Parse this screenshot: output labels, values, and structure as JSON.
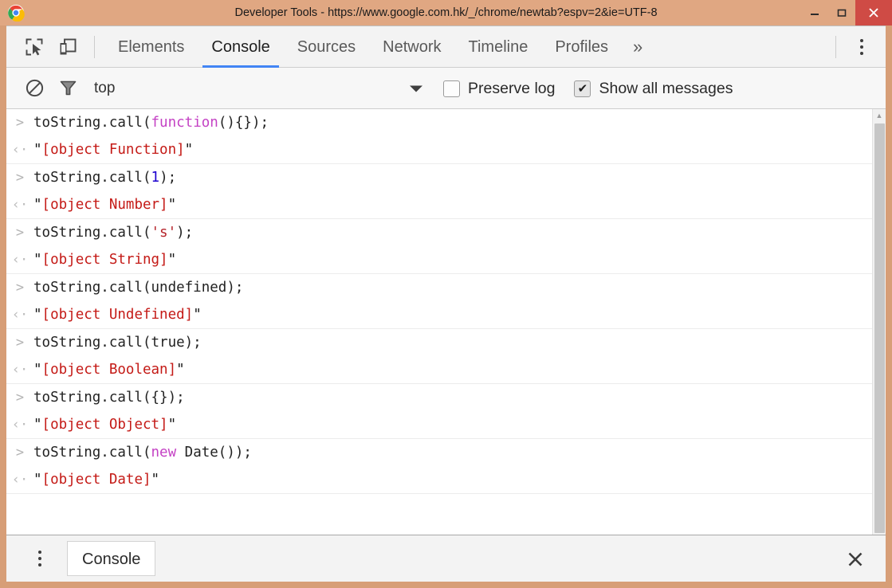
{
  "window": {
    "title": "Developer Tools - https://www.google.com.hk/_/chrome/newtab?espv=2&ie=UTF-8",
    "logo_icon": "chrome-logo-icon",
    "minimize_label": "–",
    "maximize_label": "❐",
    "close_label": "✕",
    "frame_color": "#d79e77",
    "titlebar_color": "#e0a782",
    "close_button_color": "#cf4b45"
  },
  "tabstrip": {
    "inspect_icon": "inspect-element-icon",
    "device_icon": "device-toolbar-icon",
    "more_tabs_label": "»",
    "menu_icon": "main-menu-kebab-icon",
    "accent_color": "#4285f4",
    "tabs": [
      {
        "label": "Elements",
        "active": false
      },
      {
        "label": "Console",
        "active": true
      },
      {
        "label": "Sources",
        "active": false
      },
      {
        "label": "Network",
        "active": false
      },
      {
        "label": "Timeline",
        "active": false
      },
      {
        "label": "Profiles",
        "active": false
      }
    ]
  },
  "filterbar": {
    "clear_icon": "clear-console-icon",
    "filter_icon": "filter-funnel-icon",
    "context": "top",
    "context_arrow": "▼",
    "checkboxes": [
      {
        "label": "Preserve log",
        "checked": false,
        "mark": ""
      },
      {
        "label": "Show all messages",
        "checked": true,
        "mark": "✔"
      }
    ]
  },
  "console": {
    "prompt_glyph": ">",
    "result_glyph": "‹·",
    "groups": [
      {
        "input": [
          {
            "t": "toString.call(",
            "c": "plain"
          },
          {
            "t": "function",
            "c": "kw2"
          },
          {
            "t": "(){});",
            "c": "plain"
          }
        ],
        "output_quote": "\"",
        "output_body": "[object Function]"
      },
      {
        "input": [
          {
            "t": "toString.call(",
            "c": "plain"
          },
          {
            "t": "1",
            "c": "num"
          },
          {
            "t": ");",
            "c": "plain"
          }
        ],
        "output_quote": "\"",
        "output_body": "[object Number]"
      },
      {
        "input": [
          {
            "t": "toString.call(",
            "c": "plain"
          },
          {
            "t": "'s'",
            "c": "str"
          },
          {
            "t": ");",
            "c": "plain"
          }
        ],
        "output_quote": "\"",
        "output_body": "[object String]"
      },
      {
        "input": [
          {
            "t": "toString.call(undefined);",
            "c": "plain"
          }
        ],
        "output_quote": "\"",
        "output_body": "[object Undefined]"
      },
      {
        "input": [
          {
            "t": "toString.call(true);",
            "c": "plain"
          }
        ],
        "output_quote": "\"",
        "output_body": "[object Boolean]"
      },
      {
        "input": [
          {
            "t": "toString.call({});",
            "c": "plain"
          }
        ],
        "output_quote": "\"",
        "output_body": "[object Object]"
      },
      {
        "input": [
          {
            "t": "toString.call(",
            "c": "plain"
          },
          {
            "t": "new",
            "c": "kw2"
          },
          {
            "t": " Date());",
            "c": "plain"
          }
        ],
        "output_quote": "\"",
        "output_body": "[object Date]"
      }
    ]
  },
  "scrollbar": {
    "up_arrow": "▲"
  },
  "drawer": {
    "menu_icon": "drawer-menu-kebab-icon",
    "tab_label": "Console",
    "close_label": "✕"
  }
}
